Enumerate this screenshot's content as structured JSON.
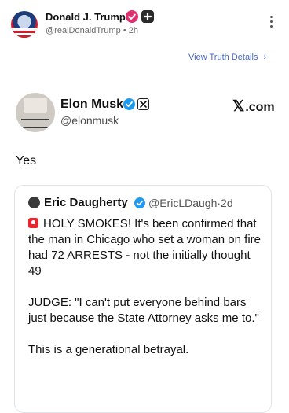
{
  "post": {
    "author_name": "Donald J. Trump",
    "handle": "@realDonaldTrump",
    "separator": "•",
    "time": "2h",
    "view_details": "View Truth Details",
    "chevron": "›"
  },
  "embed": {
    "name": "Elon Musk",
    "handle": "@elonmusk",
    "site": "X.com",
    "site_mark": "𝕏",
    "site_rest": ".com",
    "text": "Yes"
  },
  "quoted": {
    "name": "Eric Daugherty",
    "handle": "@EricLDaugh",
    "separator": "·",
    "time": "2d",
    "paragraphs": [
      "HOLY SMOKES! It's been confirmed that the man in Chicago who set a woman on fire had 72 ARRESTS - not the initially thought 49",
      "JUDGE: \"I can't put everyone behind bars just because the State Attorney asks me to.\"",
      "This is a generational betrayal."
    ]
  },
  "icons": {
    "verified_badge": "check-badge-icon",
    "plus_badge": "plus-badge-icon",
    "more": "kebab-icon",
    "siren": "siren-emoji-icon"
  },
  "colors": {
    "link": "#4a67c9",
    "x_verified": "#1d9bf0",
    "truth_verified": "#e0316f"
  }
}
